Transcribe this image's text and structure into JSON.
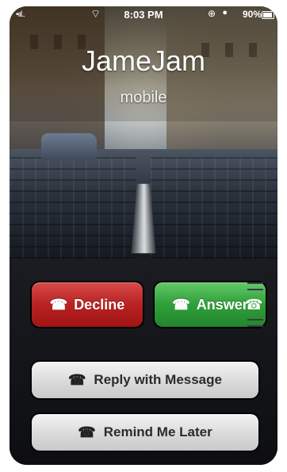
{
  "status": {
    "signal": "•ııl..",
    "wifi_icon": "wifi-icon",
    "time": "8:03 PM",
    "lock_icon": "rotation-lock-icon",
    "alarm_icon": "alarm-icon",
    "battery": "90%"
  },
  "caller": {
    "name": "JameJam",
    "type": "mobile"
  },
  "actions": {
    "decline": "Decline",
    "answer": "Answer",
    "reply": "Reply with Message",
    "remind": "Remind Me Later"
  },
  "icons": {
    "decline": "☎",
    "answer": "☎",
    "reply": "☎",
    "remind": "☎",
    "side": "☎"
  }
}
